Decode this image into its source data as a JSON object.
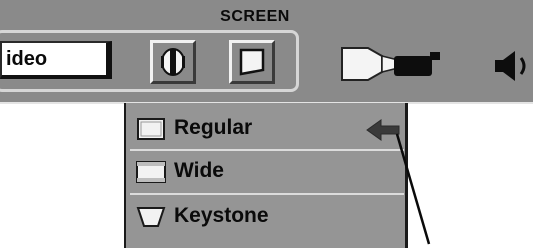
{
  "menu": {
    "title": "SCREEN",
    "input_value": "ideo"
  },
  "toolbar": {
    "icons": [
      "screen-aspect-icon",
      "keystone-frame-icon",
      "projector-icon",
      "speaker-icon"
    ]
  },
  "dropdown": {
    "items": [
      {
        "label": "Regular",
        "icon": "regular-aspect-icon",
        "selected": true
      },
      {
        "label": "Wide",
        "icon": "wide-aspect-icon",
        "selected": false
      },
      {
        "label": "Keystone",
        "icon": "keystone-icon",
        "selected": false
      }
    ]
  },
  "colors": {
    "menu_bg": "#8a8a8a",
    "highlight": "#e4e4e4",
    "text": "#0a0a0a"
  }
}
